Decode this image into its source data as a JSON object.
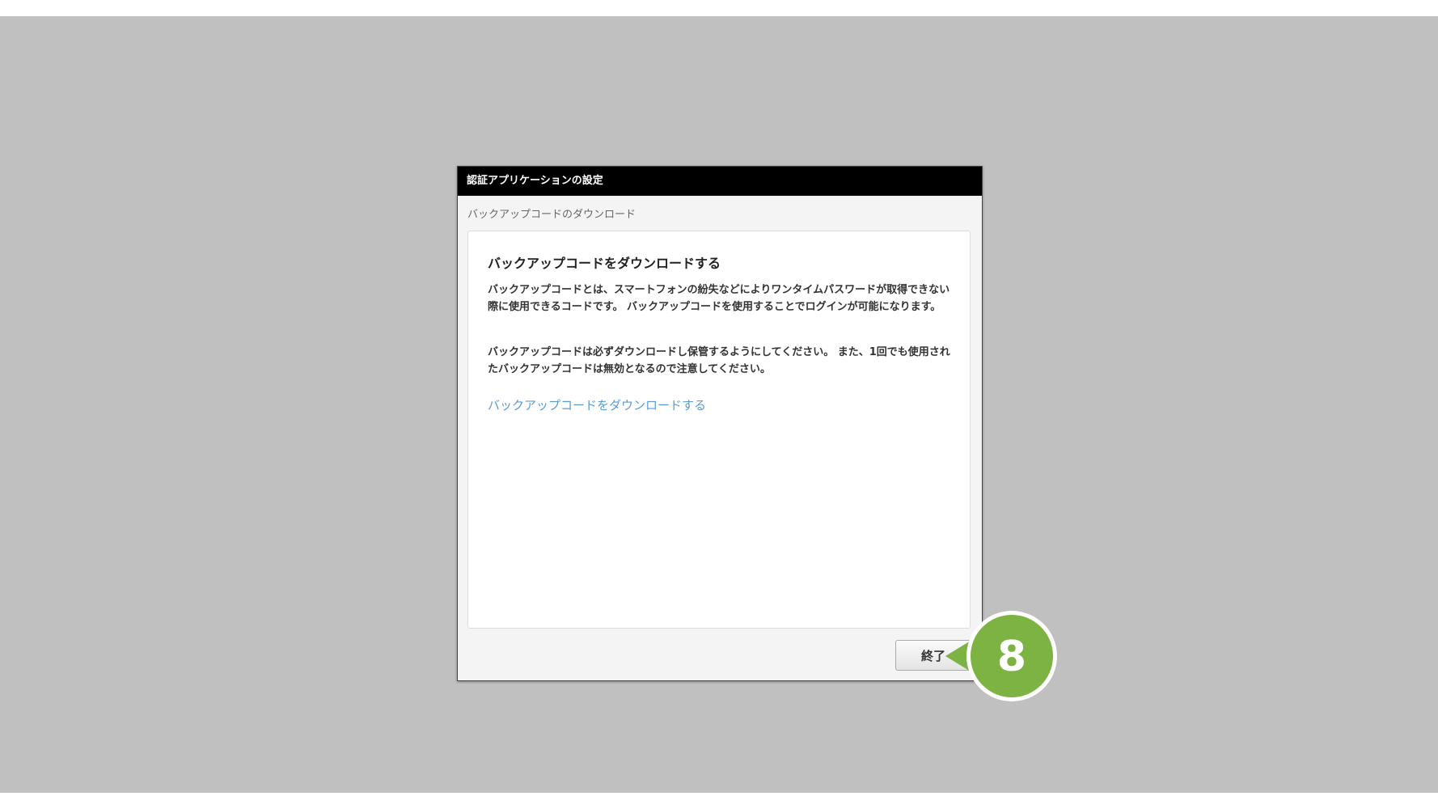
{
  "dialog": {
    "title": "認証アプリケーションの設定",
    "step_label": "バックアップコードのダウンロード",
    "heading": "バックアップコードをダウンロードする",
    "paragraph_1": "バックアップコードとは、スマートフォンの紛失などによりワンタイムパスワードが取得できない際に使用できるコードです。 バックアップコードを使用することでログインが可能になります。",
    "paragraph_2": "バックアップコードは必ずダウンロードし保管するようにしてください。 また、1回でも使用されたバックアップコードは無効となるので注意してください。",
    "download_link": "バックアップコードをダウンロードする",
    "finish_button": "終了"
  },
  "annotation": {
    "step_number": "8",
    "color": "#7cb342"
  },
  "colors": {
    "backdrop": "#c0c0c0",
    "titlebar": "#000000",
    "link": "#5b9bd5"
  }
}
